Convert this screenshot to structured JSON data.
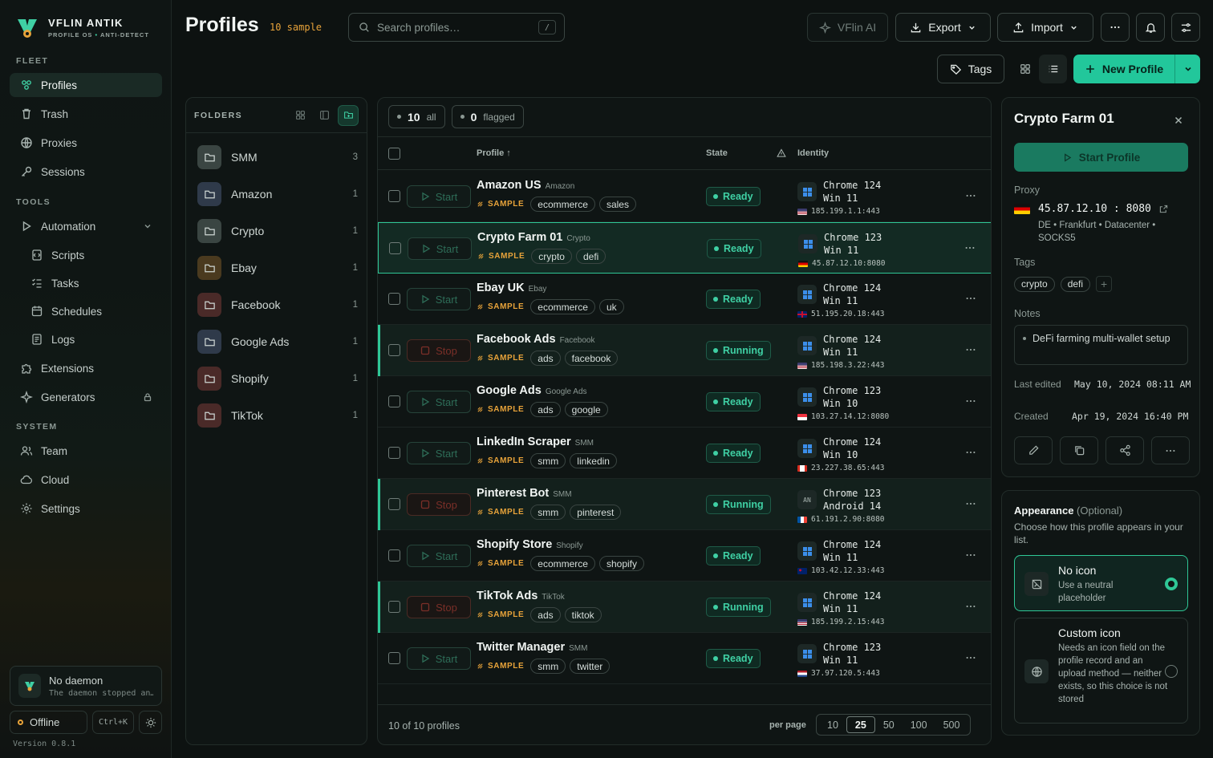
{
  "brand": {
    "name": "VFLIN ANTIK",
    "sub_a": "PROFILE OS",
    "sub_sep": " • ",
    "sub_b": "ANTI-DETECT"
  },
  "sidebar": {
    "fleet_label": "FLEET",
    "tools_label": "TOOLS",
    "system_label": "SYSTEM",
    "fleet": [
      "Profiles",
      "Trash",
      "Proxies",
      "Sessions"
    ],
    "tools": {
      "automation": "Automation",
      "scripts": "Scripts",
      "tasks": "Tasks",
      "schedules": "Schedules",
      "logs": "Logs",
      "extensions": "Extensions",
      "generators": "Generators"
    },
    "system": [
      "Team",
      "Cloud",
      "Settings"
    ],
    "daemon_title": "No daemon",
    "daemon_desc": "The daemon stopped an…",
    "status": "Offline",
    "shortcut": "Ctrl+K",
    "version": "Version 0.8.1"
  },
  "header": {
    "title": "Profiles",
    "count": "10 sample",
    "search_placeholder": "Search profiles…",
    "search_key": "/",
    "ai_label": "VFlin AI",
    "export_label": "Export",
    "import_label": "Import",
    "tags_label": "Tags",
    "new_profile_label": "New Profile"
  },
  "folders": {
    "label": "FOLDERS",
    "items": [
      {
        "name": "SMM",
        "count": "3",
        "color": "#3a4542"
      },
      {
        "name": "Amazon",
        "count": "1",
        "color": "#2f3a4a"
      },
      {
        "name": "Crypto",
        "count": "1",
        "color": "#3a4542"
      },
      {
        "name": "Ebay",
        "count": "1",
        "color": "#4a3a1f"
      },
      {
        "name": "Facebook",
        "count": "1",
        "color": "#4a2a28"
      },
      {
        "name": "Google Ads",
        "count": "1",
        "color": "#2f3a4a"
      },
      {
        "name": "Shopify",
        "count": "1",
        "color": "#4a2a28"
      },
      {
        "name": "TikTok",
        "count": "1",
        "color": "#4a2a28"
      }
    ]
  },
  "filters": {
    "all_count": "10",
    "all_label": "all",
    "flagged_count": "0",
    "flagged_label": "flagged"
  },
  "columns": {
    "profile": "Profile ↑",
    "state": "State",
    "identity": "Identity"
  },
  "sample_label": "SAMPLE",
  "profiles": [
    {
      "name": "Amazon US",
      "folder": "Amazon",
      "tags": [
        "ecommerce",
        "sales"
      ],
      "action": "Start",
      "state": "Ready",
      "browser": "Chrome 124",
      "os": "Win 11",
      "os_icon": "windows-icon",
      "ip": "185.199.1.1:443",
      "flag": "us",
      "running": false,
      "selected": false
    },
    {
      "name": "Crypto Farm 01",
      "folder": "Crypto",
      "tags": [
        "crypto",
        "defi"
      ],
      "action": "Start",
      "state": "Ready",
      "browser": "Chrome 123",
      "os": "Win 11",
      "os_icon": "windows-icon",
      "ip": "45.87.12.10:8080",
      "flag": "de",
      "running": false,
      "selected": true
    },
    {
      "name": "Ebay UK",
      "folder": "Ebay",
      "tags": [
        "ecommerce",
        "uk"
      ],
      "action": "Start",
      "state": "Ready",
      "browser": "Chrome 124",
      "os": "Win 11",
      "os_icon": "windows-icon",
      "ip": "51.195.20.18:443",
      "flag": "gb",
      "running": false,
      "selected": false
    },
    {
      "name": "Facebook Ads",
      "folder": "Facebook",
      "tags": [
        "ads",
        "facebook"
      ],
      "action": "Stop",
      "state": "Running",
      "browser": "Chrome 124",
      "os": "Win 11",
      "os_icon": "windows-icon",
      "ip": "185.198.3.22:443",
      "flag": "us",
      "running": true,
      "selected": false
    },
    {
      "name": "Google Ads",
      "folder": "Google Ads",
      "tags": [
        "ads",
        "google"
      ],
      "action": "Start",
      "state": "Ready",
      "browser": "Chrome 123",
      "os": "Win 10",
      "os_icon": "windows-icon",
      "ip": "103.27.14.12:8080",
      "flag": "sg",
      "running": false,
      "selected": false
    },
    {
      "name": "LinkedIn Scraper",
      "folder": "SMM",
      "tags": [
        "smm",
        "linkedin"
      ],
      "action": "Start",
      "state": "Ready",
      "browser": "Chrome 124",
      "os": "Win 10",
      "os_icon": "windows-icon",
      "ip": "23.227.38.65:443",
      "flag": "ca",
      "running": false,
      "selected": false
    },
    {
      "name": "Pinterest Bot",
      "folder": "SMM",
      "tags": [
        "smm",
        "pinterest"
      ],
      "action": "Stop",
      "state": "Running",
      "browser": "Chrome 123",
      "os": "Android 14",
      "os_icon": "android-icon",
      "os_badge": "AN",
      "ip": "61.191.2.90:8080",
      "flag": "fr",
      "running": true,
      "selected": false
    },
    {
      "name": "Shopify Store",
      "folder": "Shopify",
      "tags": [
        "ecommerce",
        "shopify"
      ],
      "action": "Start",
      "state": "Ready",
      "browser": "Chrome 124",
      "os": "Win 11",
      "os_icon": "windows-icon",
      "ip": "103.42.12.33:443",
      "flag": "au",
      "running": false,
      "selected": false
    },
    {
      "name": "TikTok Ads",
      "folder": "TikTok",
      "tags": [
        "ads",
        "tiktok"
      ],
      "action": "Stop",
      "state": "Running",
      "browser": "Chrome 124",
      "os": "Win 11",
      "os_icon": "windows-icon",
      "ip": "185.199.2.15:443",
      "flag": "us",
      "running": true,
      "selected": false
    },
    {
      "name": "Twitter Manager",
      "folder": "SMM",
      "tags": [
        "smm",
        "twitter"
      ],
      "action": "Start",
      "state": "Ready",
      "browser": "Chrome 123",
      "os": "Win 11",
      "os_icon": "windows-icon",
      "ip": "37.97.120.5:443",
      "flag": "nl",
      "running": false,
      "selected": false
    }
  ],
  "footer": {
    "count": "10 of 10 profiles",
    "per_page_label": "per page",
    "per_page_options": [
      "10",
      "25",
      "50",
      "100",
      "500"
    ],
    "per_page_selected": "25"
  },
  "details": {
    "title": "Crypto Farm 01",
    "start_label": "Start Profile",
    "proxy_label": "Proxy",
    "proxy_value": "45.87.12.10 : 8080",
    "proxy_meta": "DE • Frankfurt • Datacenter • SOCKS5",
    "tags_label": "Tags",
    "tags": [
      "crypto",
      "defi"
    ],
    "notes_label": "Notes",
    "note": "DeFi farming multi-wallet setup",
    "last_edited_label": "Last edited",
    "last_edited": "May 10, 2024 08:11 AM",
    "created_label": "Created",
    "created": "Apr 19, 2024 16:40 PM"
  },
  "appearance": {
    "title": "Appearance",
    "optional": "(Optional)",
    "desc": "Choose how this profile appears in your list.",
    "no_icon_title": "No icon",
    "no_icon_desc": "Use a neutral placeholder",
    "custom_title": "Custom icon",
    "custom_desc": "Needs an icon field on the profile record and an upload method — neither exists, so this choice is not stored"
  },
  "colors": {
    "accent": "#22c79b",
    "warning": "#e8a33a",
    "background": "#0d1211"
  }
}
